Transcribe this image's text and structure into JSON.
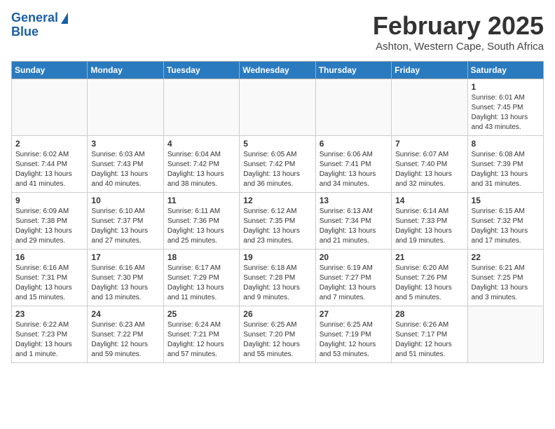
{
  "header": {
    "logo_general": "General",
    "logo_blue": "Blue",
    "month": "February 2025",
    "location": "Ashton, Western Cape, South Africa"
  },
  "weekdays": [
    "Sunday",
    "Monday",
    "Tuesday",
    "Wednesday",
    "Thursday",
    "Friday",
    "Saturday"
  ],
  "weeks": [
    [
      {
        "day": "",
        "info": ""
      },
      {
        "day": "",
        "info": ""
      },
      {
        "day": "",
        "info": ""
      },
      {
        "day": "",
        "info": ""
      },
      {
        "day": "",
        "info": ""
      },
      {
        "day": "",
        "info": ""
      },
      {
        "day": "1",
        "info": "Sunrise: 6:01 AM\nSunset: 7:45 PM\nDaylight: 13 hours\nand 43 minutes."
      }
    ],
    [
      {
        "day": "2",
        "info": "Sunrise: 6:02 AM\nSunset: 7:44 PM\nDaylight: 13 hours\nand 41 minutes."
      },
      {
        "day": "3",
        "info": "Sunrise: 6:03 AM\nSunset: 7:43 PM\nDaylight: 13 hours\nand 40 minutes."
      },
      {
        "day": "4",
        "info": "Sunrise: 6:04 AM\nSunset: 7:42 PM\nDaylight: 13 hours\nand 38 minutes."
      },
      {
        "day": "5",
        "info": "Sunrise: 6:05 AM\nSunset: 7:42 PM\nDaylight: 13 hours\nand 36 minutes."
      },
      {
        "day": "6",
        "info": "Sunrise: 6:06 AM\nSunset: 7:41 PM\nDaylight: 13 hours\nand 34 minutes."
      },
      {
        "day": "7",
        "info": "Sunrise: 6:07 AM\nSunset: 7:40 PM\nDaylight: 13 hours\nand 32 minutes."
      },
      {
        "day": "8",
        "info": "Sunrise: 6:08 AM\nSunset: 7:39 PM\nDaylight: 13 hours\nand 31 minutes."
      }
    ],
    [
      {
        "day": "9",
        "info": "Sunrise: 6:09 AM\nSunset: 7:38 PM\nDaylight: 13 hours\nand 29 minutes."
      },
      {
        "day": "10",
        "info": "Sunrise: 6:10 AM\nSunset: 7:37 PM\nDaylight: 13 hours\nand 27 minutes."
      },
      {
        "day": "11",
        "info": "Sunrise: 6:11 AM\nSunset: 7:36 PM\nDaylight: 13 hours\nand 25 minutes."
      },
      {
        "day": "12",
        "info": "Sunrise: 6:12 AM\nSunset: 7:35 PM\nDaylight: 13 hours\nand 23 minutes."
      },
      {
        "day": "13",
        "info": "Sunrise: 6:13 AM\nSunset: 7:34 PM\nDaylight: 13 hours\nand 21 minutes."
      },
      {
        "day": "14",
        "info": "Sunrise: 6:14 AM\nSunset: 7:33 PM\nDaylight: 13 hours\nand 19 minutes."
      },
      {
        "day": "15",
        "info": "Sunrise: 6:15 AM\nSunset: 7:32 PM\nDaylight: 13 hours\nand 17 minutes."
      }
    ],
    [
      {
        "day": "16",
        "info": "Sunrise: 6:16 AM\nSunset: 7:31 PM\nDaylight: 13 hours\nand 15 minutes."
      },
      {
        "day": "17",
        "info": "Sunrise: 6:16 AM\nSunset: 7:30 PM\nDaylight: 13 hours\nand 13 minutes."
      },
      {
        "day": "18",
        "info": "Sunrise: 6:17 AM\nSunset: 7:29 PM\nDaylight: 13 hours\nand 11 minutes."
      },
      {
        "day": "19",
        "info": "Sunrise: 6:18 AM\nSunset: 7:28 PM\nDaylight: 13 hours\nand 9 minutes."
      },
      {
        "day": "20",
        "info": "Sunrise: 6:19 AM\nSunset: 7:27 PM\nDaylight: 13 hours\nand 7 minutes."
      },
      {
        "day": "21",
        "info": "Sunrise: 6:20 AM\nSunset: 7:26 PM\nDaylight: 13 hours\nand 5 minutes."
      },
      {
        "day": "22",
        "info": "Sunrise: 6:21 AM\nSunset: 7:25 PM\nDaylight: 13 hours\nand 3 minutes."
      }
    ],
    [
      {
        "day": "23",
        "info": "Sunrise: 6:22 AM\nSunset: 7:23 PM\nDaylight: 13 hours\nand 1 minute."
      },
      {
        "day": "24",
        "info": "Sunrise: 6:23 AM\nSunset: 7:22 PM\nDaylight: 12 hours\nand 59 minutes."
      },
      {
        "day": "25",
        "info": "Sunrise: 6:24 AM\nSunset: 7:21 PM\nDaylight: 12 hours\nand 57 minutes."
      },
      {
        "day": "26",
        "info": "Sunrise: 6:25 AM\nSunset: 7:20 PM\nDaylight: 12 hours\nand 55 minutes."
      },
      {
        "day": "27",
        "info": "Sunrise: 6:25 AM\nSunset: 7:19 PM\nDaylight: 12 hours\nand 53 minutes."
      },
      {
        "day": "28",
        "info": "Sunrise: 6:26 AM\nSunset: 7:17 PM\nDaylight: 12 hours\nand 51 minutes."
      },
      {
        "day": "",
        "info": ""
      }
    ]
  ]
}
